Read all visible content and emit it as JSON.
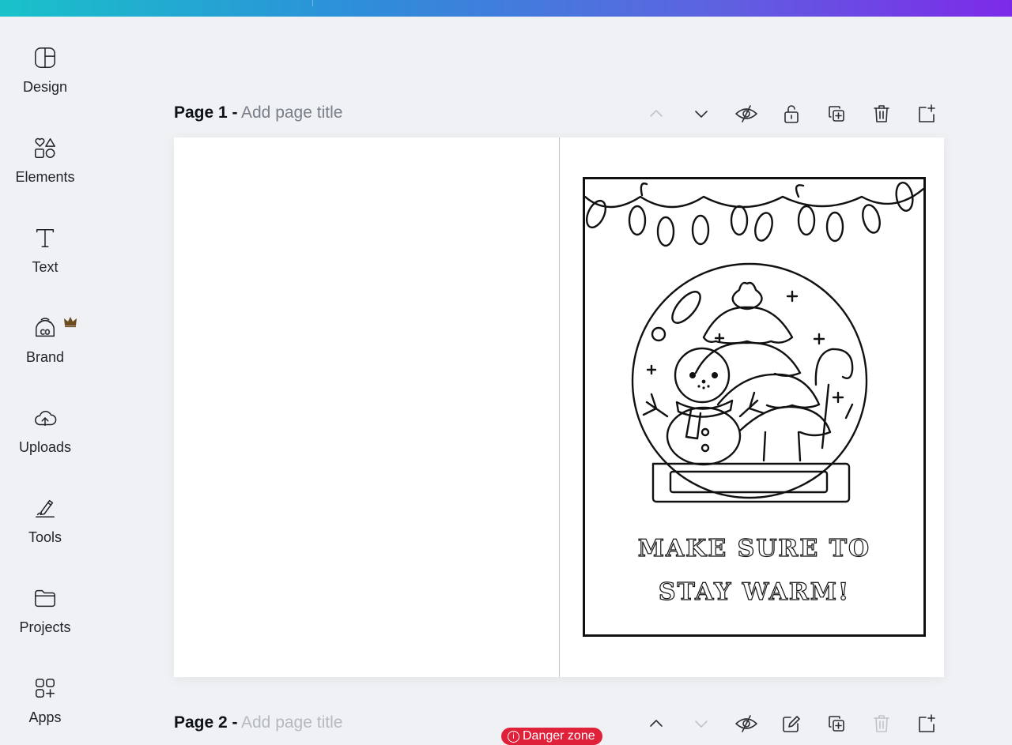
{
  "sidebar": {
    "items": [
      {
        "label": "Design",
        "icon": "layout-icon"
      },
      {
        "label": "Elements",
        "icon": "shapes-icon"
      },
      {
        "label": "Text",
        "icon": "text-icon"
      },
      {
        "label": "Brand",
        "icon": "brand-icon"
      },
      {
        "label": "Uploads",
        "icon": "cloud-upload-icon"
      },
      {
        "label": "Tools",
        "icon": "pen-tool-icon"
      },
      {
        "label": "Projects",
        "icon": "folder-icon"
      },
      {
        "label": "Apps",
        "icon": "apps-icon"
      }
    ]
  },
  "page1": {
    "title": "Page 1 -",
    "subtitle": "Add page title"
  },
  "page2": {
    "title": "Page 2 -",
    "subtitle": "Add page title"
  },
  "card": {
    "line1": "MAKE SURE TO",
    "line2": "STAY WARM!"
  },
  "danger_badge": {
    "label": "Danger zone",
    "color": "#e0213a"
  },
  "colors": {
    "topbar_start": "#19c2c9",
    "topbar_end": "#7d2ae8",
    "background": "#eff1f4"
  }
}
